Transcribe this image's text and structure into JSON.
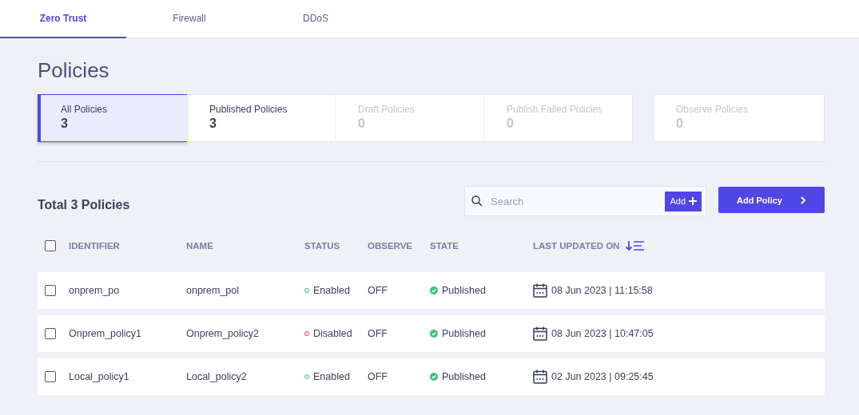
{
  "tabs": [
    {
      "label": "Zero Trust",
      "selected": true
    },
    {
      "label": "Firewall",
      "selected": false
    },
    {
      "label": "DDoS",
      "selected": false
    }
  ],
  "title": "Policies",
  "stat_groups": [
    [
      {
        "label": "All Policies",
        "count": "3",
        "selected": true,
        "disabled": false
      },
      {
        "label": "Published Policies",
        "count": "3",
        "selected": false,
        "disabled": false
      },
      {
        "label": "Draft Policies",
        "count": "0",
        "selected": false,
        "disabled": true
      },
      {
        "label": "Publish Failed Policies",
        "count": "0",
        "selected": false,
        "disabled": true
      }
    ],
    [
      {
        "label": "Observe Policies",
        "count": "0",
        "selected": false,
        "disabled": true
      }
    ]
  ],
  "total": "Total 3 Policies",
  "search": {
    "placeholder": "Search",
    "add_label": "Add"
  },
  "add_policy": "Add Policy",
  "table": {
    "select_all_checked": false,
    "columns": [
      "IDENTIFIER",
      "NAME",
      "STATUS",
      "OBSERVE",
      "STATE",
      "LAST UPDATED ON"
    ],
    "rows": [
      {
        "checked": false,
        "identifier": "onprem_po",
        "name": "onprem_pol",
        "status": "Enabled",
        "enabled": true,
        "observe": "OFF",
        "state": "Published",
        "updated": "08 Jun 2023 | 11:15:58"
      },
      {
        "checked": false,
        "identifier": "Onprem_policy1",
        "name": "Onprem_policy2",
        "status": "Disabled",
        "enabled": false,
        "observe": "OFF",
        "state": "Published",
        "updated": "08 Jun 2023 | 10:47:05"
      },
      {
        "checked": false,
        "identifier": "Local_policy1",
        "name": "Local_policy2",
        "status": "Enabled",
        "enabled": true,
        "observe": "OFF",
        "state": "Published",
        "updated": "02 Jun 2023 | 09:25:45"
      }
    ]
  }
}
